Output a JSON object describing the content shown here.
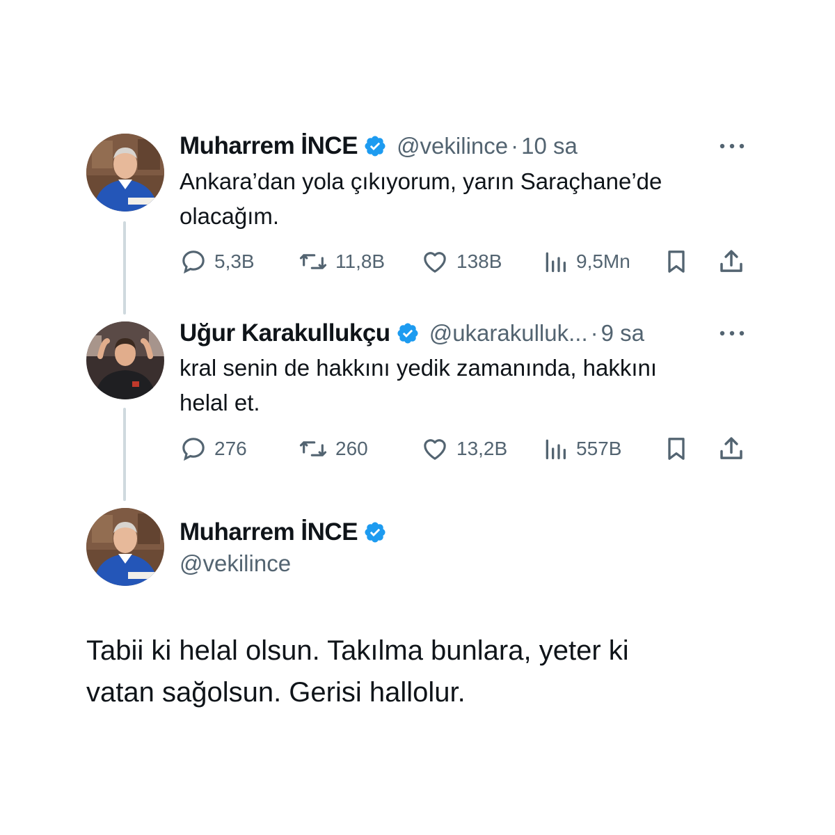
{
  "colors": {
    "text_primary": "#0f1419",
    "text_secondary": "#536471",
    "verified_blue": "#1d9bf0",
    "thread_line": "#cfd9de"
  },
  "tweets": [
    {
      "name": "Muharrem İNCE",
      "handle": "@vekilince",
      "separator": "·",
      "time": "10 sa",
      "text_lines": [
        "Ankara’dan yola çıkıyorum, yarın Saraçhane’de",
        "olacağım."
      ],
      "replies": "5,3B",
      "retweets": "11,8B",
      "likes": "138B",
      "views": "9,5Mn"
    },
    {
      "name": "Uğur Karakullukçu",
      "handle": "@ukarakulluk...",
      "separator": "·",
      "time": "9 sa",
      "text_lines": [
        "kral senin de hakkını yedik zamanında, hakkını",
        "helal et."
      ],
      "replies": "276",
      "retweets": "260",
      "likes": "13,2B",
      "views": "557B"
    }
  ],
  "main_tweet": {
    "name": "Muharrem İNCE",
    "handle": "@vekilince",
    "text_lines": [
      "Tabii ki helal olsun. Takılma bunlara, yeter ki",
      "vatan sağolsun. Gerisi hallolur."
    ]
  },
  "icons": {
    "verified": "verified-badge-icon",
    "more": "more-options-icon",
    "reply": "reply-icon",
    "retweet": "retweet-icon",
    "like": "like-icon",
    "views": "views-icon",
    "bookmark": "bookmark-icon",
    "share": "share-icon"
  }
}
